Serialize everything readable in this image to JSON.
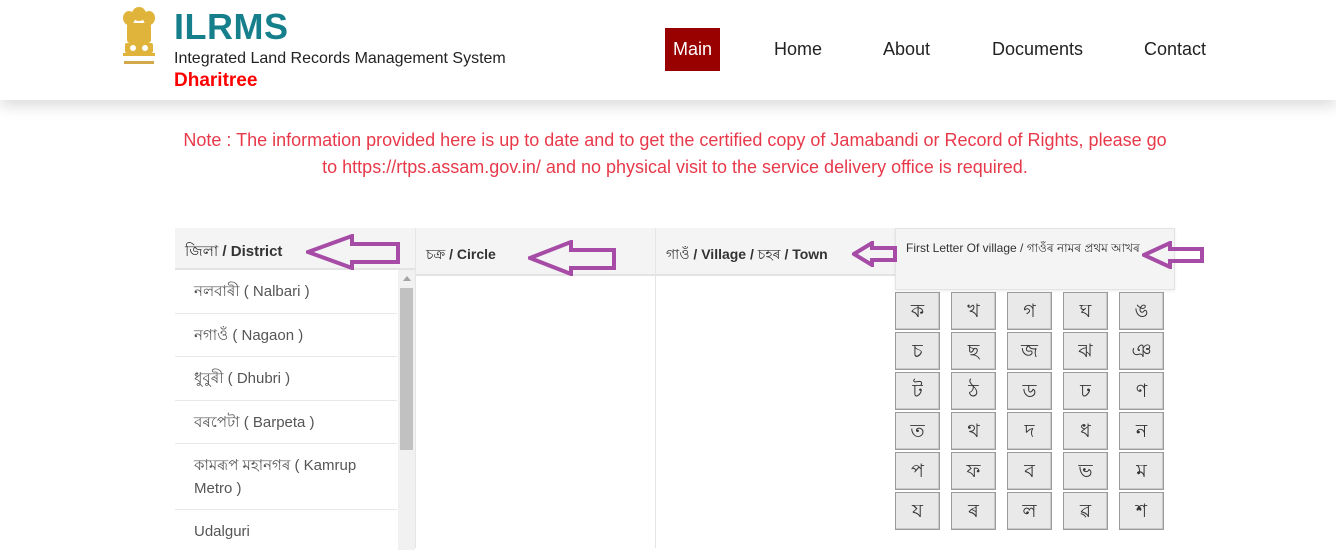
{
  "header": {
    "logo_alt": "emblem-of-india",
    "title": "ILRMS",
    "subtitle": "Integrated Land Records Management System",
    "brand": "Dharitree",
    "nav": [
      {
        "label": "Main",
        "active": true
      },
      {
        "label": "Home",
        "active": false
      },
      {
        "label": "About",
        "active": false
      },
      {
        "label": "Documents",
        "active": false
      },
      {
        "label": "Contact",
        "active": false
      }
    ]
  },
  "note": {
    "line1": "Note : The information provided here is up to date and to get the certified copy of Jamabandi or Record of Rights, please go",
    "line2": "to https://rtps.assam.gov.in/ and no physical visit to the service delivery office is required."
  },
  "columns": {
    "district": {
      "header_bn": "জিলা",
      "header_en": " / District",
      "items": [
        "নলবাৰী ( Nalbari )",
        "নগাওঁ ( Nagaon )",
        "ধুবুৰী ( Dhubri )",
        "বৰপেটা ( Barpeta )",
        "কামৰূপ মহানগৰ ( Kamrup Metro )",
        "Udalguri"
      ]
    },
    "circle": {
      "header_bn": "চক্ৰ",
      "header_en": " / Circle"
    },
    "village": {
      "header_bn": "গাওঁ",
      "header_en": " / Village / ",
      "header_bn2": "চহৰ",
      "header_en2": " / Town"
    },
    "letters": {
      "header": "First Letter Of village / গাওঁৰ নামৰ প্ৰথম আখৰ",
      "rows": [
        [
          "ক",
          "খ",
          "গ",
          "ঘ",
          "ঙ"
        ],
        [
          "চ",
          "ছ",
          "জ",
          "ঝ",
          "ঞ"
        ],
        [
          "ট",
          "ঠ",
          "ড",
          "ঢ",
          "ণ"
        ],
        [
          "ত",
          "থ",
          "দ",
          "ধ",
          "ন"
        ],
        [
          "প",
          "ফ",
          "ব",
          "ভ",
          "ম"
        ],
        [
          "য",
          "ৰ",
          "ল",
          "ৱ",
          "শ"
        ]
      ]
    }
  },
  "colors": {
    "title": "#157f8c",
    "brand": "#ff0000",
    "nav_active_bg": "#990000",
    "note": "#e8394a",
    "arrow": "#a64ca6"
  }
}
